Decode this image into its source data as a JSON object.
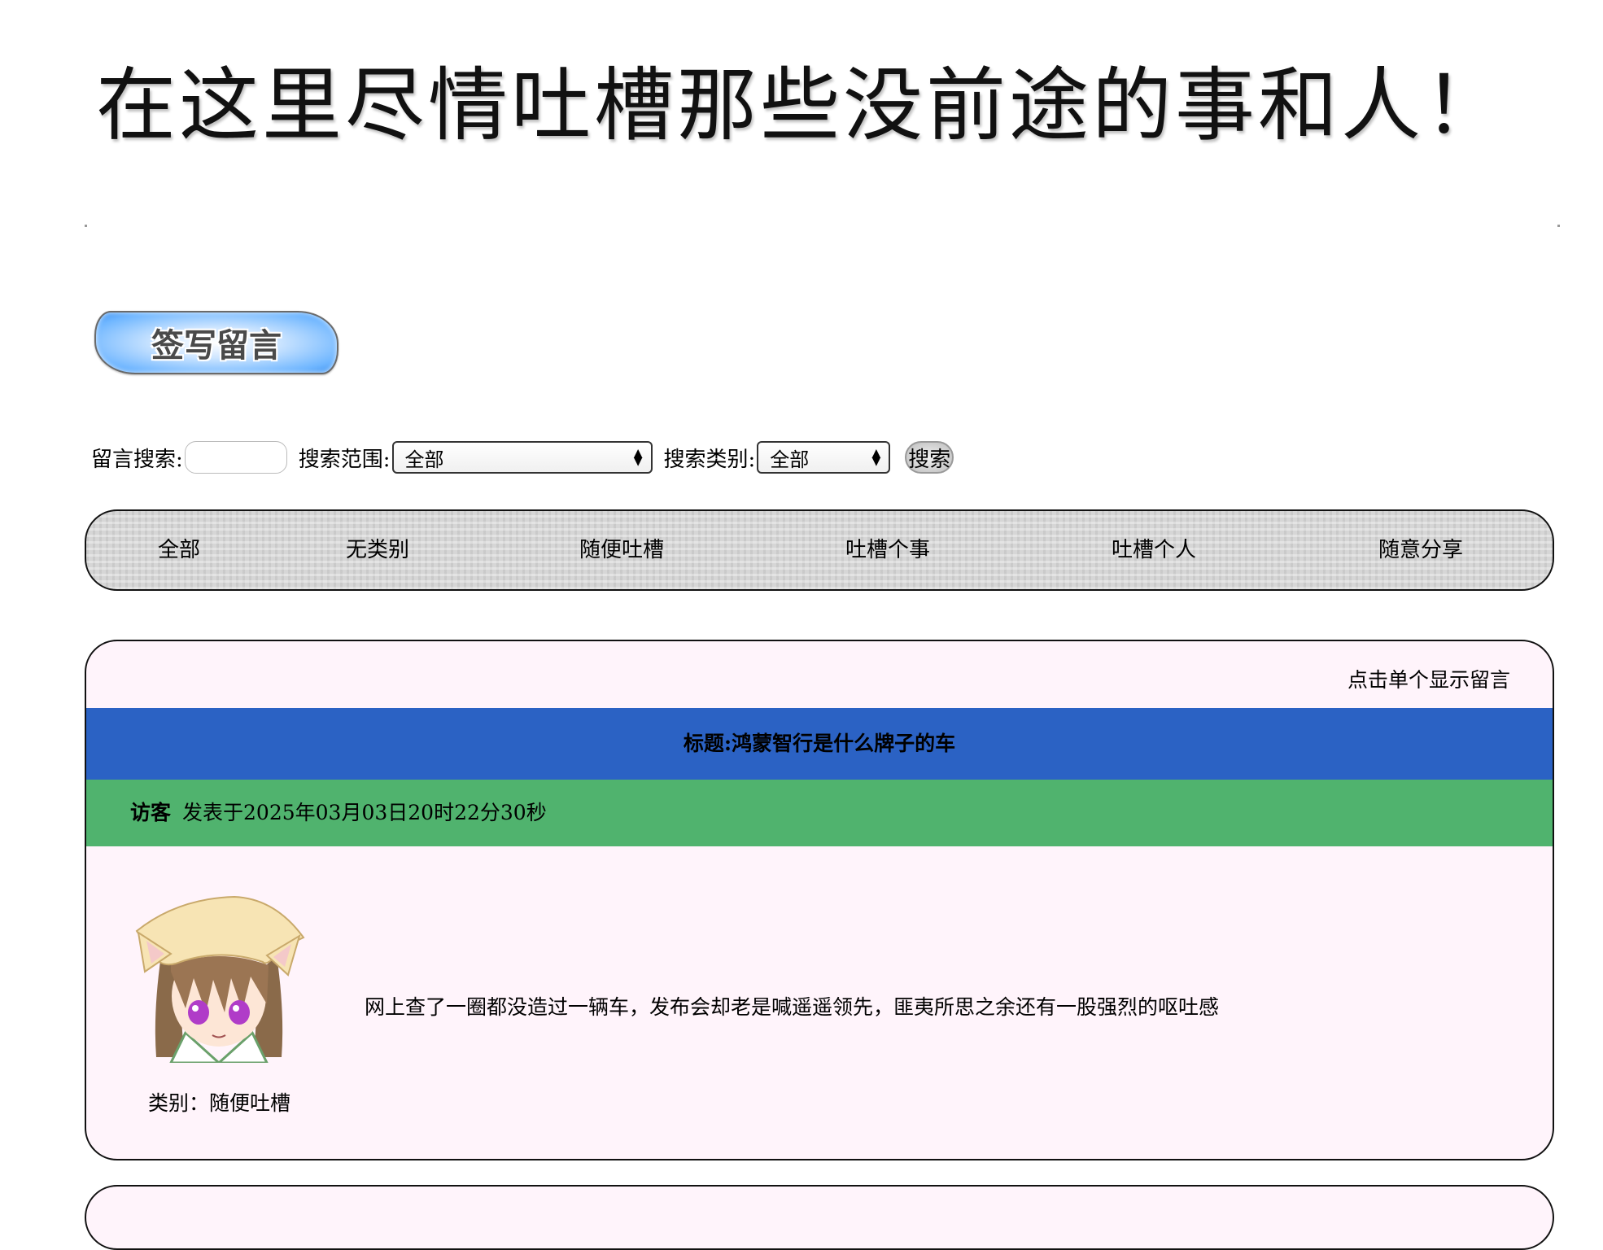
{
  "banner": {
    "title": "在这里尽情吐槽那些没前途的事和人！"
  },
  "actions": {
    "sign_label": "签写留言"
  },
  "search": {
    "keyword_label": "留言搜索:",
    "keyword_value": "",
    "range_label": "搜索范围:",
    "range_selected": "全部",
    "category_label": "搜索类别:",
    "category_selected": "全部",
    "submit_label": "搜索"
  },
  "categories": [
    {
      "label": "全部"
    },
    {
      "label": "无类别"
    },
    {
      "label": "随便吐槽"
    },
    {
      "label": "吐槽个事"
    },
    {
      "label": "吐槽个人"
    },
    {
      "label": "随意分享"
    }
  ],
  "messages": [
    {
      "hint": "点击单个显示留言",
      "title": "标题:鸿蒙智行是什么牌子的车",
      "author": "访客",
      "posted": "发表于2025年03月03日20时22分30秒",
      "body": "网上查了一圈都没造过一辆车，发布会却老是喊遥遥领先，匪夷所思之余还有一股强烈的呕吐感",
      "category": "类别：随便吐槽",
      "avatar_icon": "anime-cat-girl-avatar-icon"
    }
  ],
  "colors": {
    "title_bar": "#2b62c4",
    "meta_bar": "#50b36e",
    "card_bg": "#fff4fb"
  }
}
